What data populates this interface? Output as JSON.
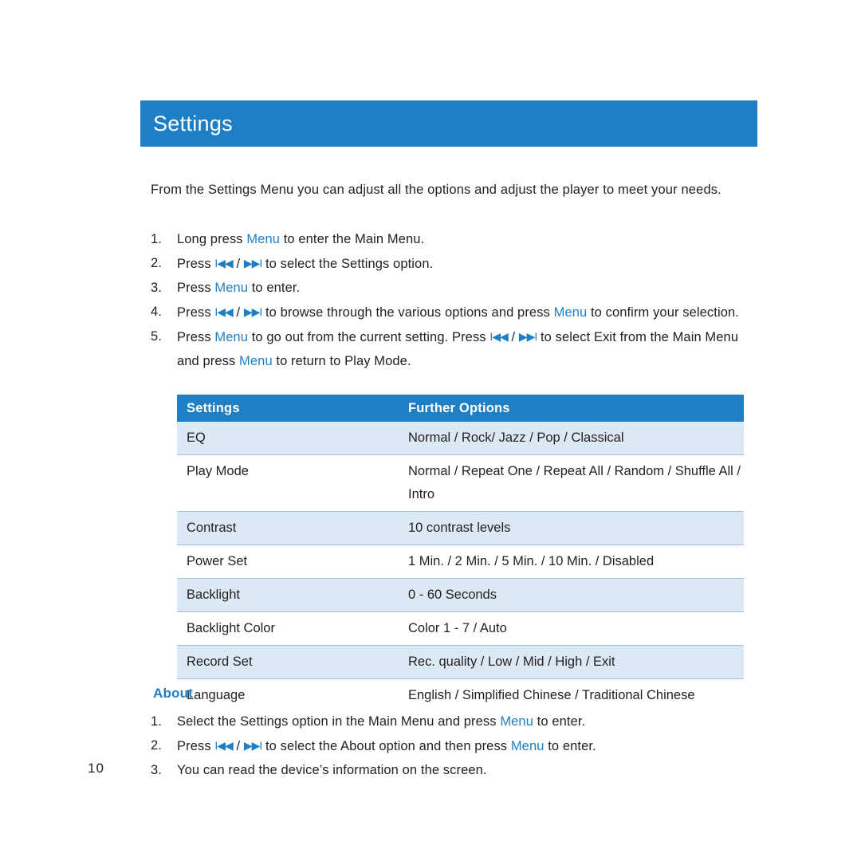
{
  "page": {
    "number": "10"
  },
  "header": {
    "title": "Settings"
  },
  "intro": {
    "text": "From the Settings Menu you can adjust all the options and adjust the player to meet your needs."
  },
  "steps": [
    {
      "num": "1.",
      "parts": [
        {
          "t": "Long press ",
          "k": false
        },
        {
          "t": "Menu ",
          "k": true
        },
        {
          "t": "to enter the Main Menu.",
          "k": false
        }
      ]
    },
    {
      "num": "2.",
      "parts": [
        {
          "t": "Press ",
          "k": false
        },
        {
          "t": "I◀◀",
          "k": true
        },
        {
          "t": " / ",
          "k": false
        },
        {
          "t": "▶▶I",
          "k": true
        },
        {
          "t": " to select the Settings option.",
          "k": false
        }
      ]
    },
    {
      "num": "3.",
      "parts": [
        {
          "t": "Press ",
          "k": false
        },
        {
          "t": "Menu ",
          "k": true
        },
        {
          "t": "to enter.",
          "k": false
        }
      ]
    },
    {
      "num": "4.",
      "parts": [
        {
          "t": "Press ",
          "k": false
        },
        {
          "t": "I◀◀",
          "k": true
        },
        {
          "t": " / ",
          "k": false
        },
        {
          "t": "▶▶I",
          "k": true
        },
        {
          "t": " to browse through the various options and press ",
          "k": false
        },
        {
          "t": "Menu ",
          "k": true
        },
        {
          "t": "to confirm your selection.",
          "k": false
        }
      ]
    },
    {
      "num": "5.",
      "parts": [
        {
          "t": "Press ",
          "k": false
        },
        {
          "t": "Menu ",
          "k": true
        },
        {
          "t": "to go out from the current setting. Press ",
          "k": false
        },
        {
          "t": "I◀◀",
          "k": true
        },
        {
          "t": " / ",
          "k": false
        },
        {
          "t": "▶▶I",
          "k": true
        },
        {
          "t": " to select Exit from the Main Menu and press ",
          "k": false
        },
        {
          "t": "Menu ",
          "k": true
        },
        {
          "t": "to return to Play Mode.",
          "k": false
        }
      ]
    }
  ],
  "table": {
    "headers": [
      "Settings",
      "Further Options"
    ],
    "rows": [
      {
        "setting": "EQ",
        "options": "Normal / Rock/ Jazz / Pop / Classical",
        "shade": true
      },
      {
        "setting": "Play Mode",
        "options": "Normal / Repeat One / Repeat All / Random / Shuffle All / Intro",
        "shade": false
      },
      {
        "setting": "Contrast",
        "options": "10 contrast levels",
        "shade": true
      },
      {
        "setting": "Power Set",
        "options": "1 Min. / 2 Min. / 5 Min. / 10 Min. / Disabled",
        "shade": false
      },
      {
        "setting": "Backlight",
        "options": "0 - 60 Seconds",
        "shade": true
      },
      {
        "setting": "Backlight Color",
        "options": "Color 1 - 7 / Auto",
        "shade": false
      },
      {
        "setting": "Record Set",
        "options": "Rec. quality / Low /  Mid / High / Exit",
        "shade": true
      },
      {
        "setting": "Language",
        "options": "English / Simplified Chinese / Traditional Chinese",
        "shade": false
      }
    ]
  },
  "about": {
    "heading": "About",
    "steps": [
      {
        "num": "1.",
        "parts": [
          {
            "t": "Select the Settings option in the Main Menu and press ",
            "k": false
          },
          {
            "t": "Menu ",
            "k": true
          },
          {
            "t": "to enter.",
            "k": false
          }
        ]
      },
      {
        "num": "2.",
        "parts": [
          {
            "t": "Press ",
            "k": false
          },
          {
            "t": "I◀◀",
            "k": true
          },
          {
            "t": " / ",
            "k": false
          },
          {
            "t": "▶▶I",
            "k": true
          },
          {
            "t": " to select the About option and then press ",
            "k": false
          },
          {
            "t": "Menu ",
            "k": true
          },
          {
            "t": "to enter.",
            "k": false
          }
        ]
      },
      {
        "num": "3.",
        "parts": [
          {
            "t": "You can read the device’s information on the screen.",
            "k": false
          }
        ]
      }
    ]
  },
  "colors": {
    "accent": "#1f7fc4",
    "table_shade": "#dce9f4",
    "text": "#231f20"
  }
}
